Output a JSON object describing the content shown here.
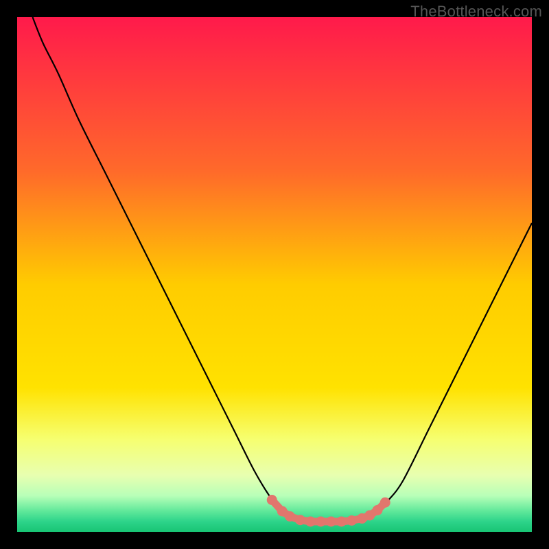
{
  "watermark": "TheBottleneck.com",
  "chart_data": {
    "type": "line",
    "title": "",
    "xlabel": "",
    "ylabel": "",
    "xlim": [
      0,
      100
    ],
    "ylim": [
      0,
      100
    ],
    "series": [
      {
        "name": "curve",
        "values": [
          [
            3,
            100
          ],
          [
            5,
            95
          ],
          [
            8,
            89
          ],
          [
            12,
            80
          ],
          [
            17,
            70
          ],
          [
            22,
            60
          ],
          [
            27,
            50
          ],
          [
            32,
            40
          ],
          [
            37,
            30
          ],
          [
            42,
            20
          ],
          [
            46,
            12
          ],
          [
            49,
            7
          ],
          [
            51,
            4.5
          ],
          [
            53,
            3
          ],
          [
            55,
            2.2
          ],
          [
            57,
            2
          ],
          [
            60,
            2
          ],
          [
            63,
            2
          ],
          [
            66,
            2.3
          ],
          [
            68,
            3
          ],
          [
            70,
            4
          ],
          [
            72,
            6
          ],
          [
            75,
            10
          ],
          [
            80,
            20
          ],
          [
            85,
            30
          ],
          [
            90,
            40
          ],
          [
            95,
            50
          ],
          [
            100,
            60
          ]
        ]
      },
      {
        "name": "markers",
        "values": [
          [
            49.5,
            6.2
          ],
          [
            51.5,
            4.0
          ],
          [
            53.0,
            3.0
          ],
          [
            55.0,
            2.3
          ],
          [
            57.0,
            2.0
          ],
          [
            59.0,
            2.0
          ],
          [
            61.0,
            2.0
          ],
          [
            63.0,
            2.0
          ],
          [
            65.0,
            2.2
          ],
          [
            67.0,
            2.6
          ],
          [
            68.5,
            3.2
          ],
          [
            70.0,
            4.2
          ],
          [
            71.5,
            5.7
          ]
        ]
      }
    ],
    "gradient_stops": [
      {
        "offset": 0,
        "color": "#ff1a4b"
      },
      {
        "offset": 30,
        "color": "#ff6a2a"
      },
      {
        "offset": 52,
        "color": "#ffcc00"
      },
      {
        "offset": 72,
        "color": "#ffe200"
      },
      {
        "offset": 82,
        "color": "#f6ff70"
      },
      {
        "offset": 89,
        "color": "#e8ffb0"
      },
      {
        "offset": 93,
        "color": "#b8ffb8"
      },
      {
        "offset": 96,
        "color": "#5fe89a"
      },
      {
        "offset": 98,
        "color": "#2dd48a"
      },
      {
        "offset": 100,
        "color": "#18c574"
      }
    ],
    "marker_color": "#e2766d",
    "curve_color": "#000000"
  }
}
